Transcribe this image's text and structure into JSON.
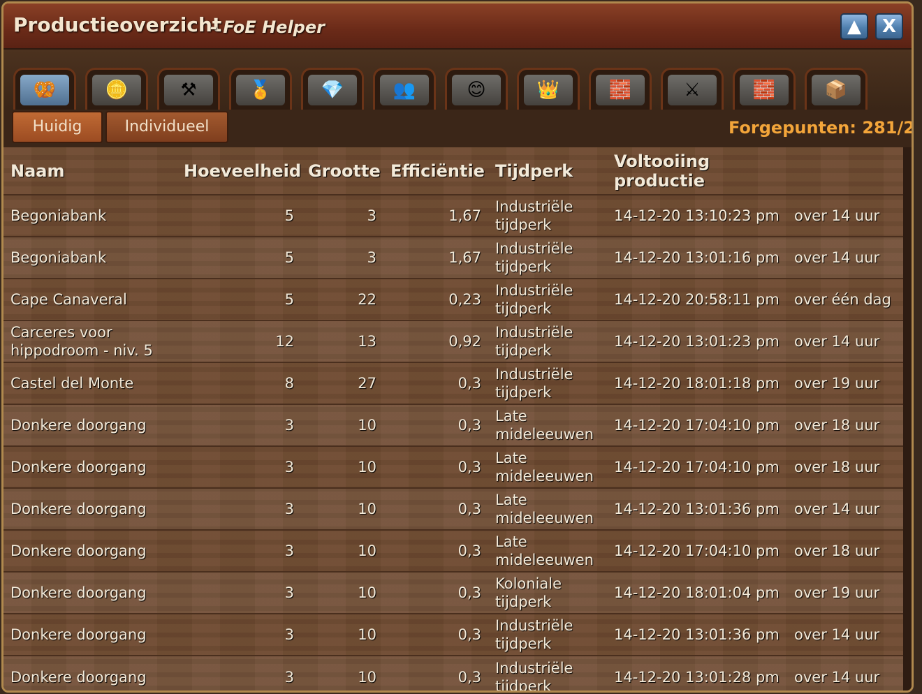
{
  "window": {
    "title": "Productieoverzicht",
    "subtitle": "- FoE Helper",
    "minimize_icon": "▲",
    "close_icon": "X"
  },
  "tabs": [
    {
      "icon": "supplies-icon",
      "glyph": "🥨",
      "active": true
    },
    {
      "icon": "coins-icon",
      "glyph": "🪙",
      "active": false
    },
    {
      "icon": "tools-icon",
      "glyph": "⚒",
      "active": false
    },
    {
      "icon": "medal-icon",
      "glyph": "🏅",
      "active": false
    },
    {
      "icon": "diamond-icon",
      "glyph": "💎",
      "active": false
    },
    {
      "icon": "population-icon",
      "glyph": "👥",
      "active": false
    },
    {
      "icon": "happiness-icon",
      "glyph": "😊",
      "active": false
    },
    {
      "icon": "crown-icon",
      "glyph": "👑",
      "active": false
    },
    {
      "icon": "goods-icon",
      "glyph": "🧱",
      "active": false
    },
    {
      "icon": "military-icon",
      "glyph": "⚔",
      "active": false
    },
    {
      "icon": "goods-alt-icon",
      "glyph": "🧱",
      "active": false
    },
    {
      "icon": "crate-icon",
      "glyph": "📦",
      "active": false
    }
  ],
  "subtabs": {
    "current": "Huidig",
    "individual": "Individueel"
  },
  "forgepoints": "Forgepunten: 281/2",
  "sort_arrow": "↑",
  "table": {
    "headers": {
      "name": "Naam",
      "amount": "Hoeveelheid",
      "size": "Grootte",
      "efficiency": "Efficiëntie",
      "era": "Tijdperk",
      "completion": "Voltooiing productie",
      "remaining": ""
    },
    "rows": [
      {
        "name": "Begoniabank",
        "amount": "5",
        "size": "3",
        "efficiency": "1,67",
        "era": "Industriële tijdperk",
        "completion": "14-12-20 13:10:23 pm",
        "remaining": "over 14 uur"
      },
      {
        "name": "Begoniabank",
        "amount": "5",
        "size": "3",
        "efficiency": "1,67",
        "era": "Industriële tijdperk",
        "completion": "14-12-20 13:01:16 pm",
        "remaining": "over 14 uur"
      },
      {
        "name": "Cape Canaveral",
        "amount": "5",
        "size": "22",
        "efficiency": "0,23",
        "era": "Industriële tijdperk",
        "completion": "14-12-20 20:58:11 pm",
        "remaining": "over één dag"
      },
      {
        "name": "Carceres voor hippodroom - niv. 5",
        "amount": "12",
        "size": "13",
        "efficiency": "0,92",
        "era": "Industriële tijdperk",
        "completion": "14-12-20 13:01:23 pm",
        "remaining": "over 14 uur"
      },
      {
        "name": "Castel del Monte",
        "amount": "8",
        "size": "27",
        "efficiency": "0,3",
        "era": "Industriële tijdperk",
        "completion": "14-12-20 18:01:18 pm",
        "remaining": "over 19 uur"
      },
      {
        "name": "Donkere doorgang",
        "amount": "3",
        "size": "10",
        "efficiency": "0,3",
        "era": "Late mideleeuwen",
        "completion": "14-12-20 17:04:10 pm",
        "remaining": "over 18 uur"
      },
      {
        "name": "Donkere doorgang",
        "amount": "3",
        "size": "10",
        "efficiency": "0,3",
        "era": "Late mideleeuwen",
        "completion": "14-12-20 17:04:10 pm",
        "remaining": "over 18 uur"
      },
      {
        "name": "Donkere doorgang",
        "amount": "3",
        "size": "10",
        "efficiency": "0,3",
        "era": "Late mideleeuwen",
        "completion": "14-12-20 13:01:36 pm",
        "remaining": "over 14 uur"
      },
      {
        "name": "Donkere doorgang",
        "amount": "3",
        "size": "10",
        "efficiency": "0,3",
        "era": "Late mideleeuwen",
        "completion": "14-12-20 17:04:10 pm",
        "remaining": "over 18 uur"
      },
      {
        "name": "Donkere doorgang",
        "amount": "3",
        "size": "10",
        "efficiency": "0,3",
        "era": "Koloniale tijdperk",
        "completion": "14-12-20 18:01:04 pm",
        "remaining": "over 19 uur"
      },
      {
        "name": "Donkere doorgang",
        "amount": "3",
        "size": "10",
        "efficiency": "0,3",
        "era": "Industriële tijdperk",
        "completion": "14-12-20 13:01:36 pm",
        "remaining": "over 14 uur"
      },
      {
        "name": "Donkere doorgang",
        "amount": "3",
        "size": "10",
        "efficiency": "0,3",
        "era": "Industriële tijdperk",
        "completion": "14-12-20 13:01:28 pm",
        "remaining": "over 14 uur"
      }
    ]
  }
}
